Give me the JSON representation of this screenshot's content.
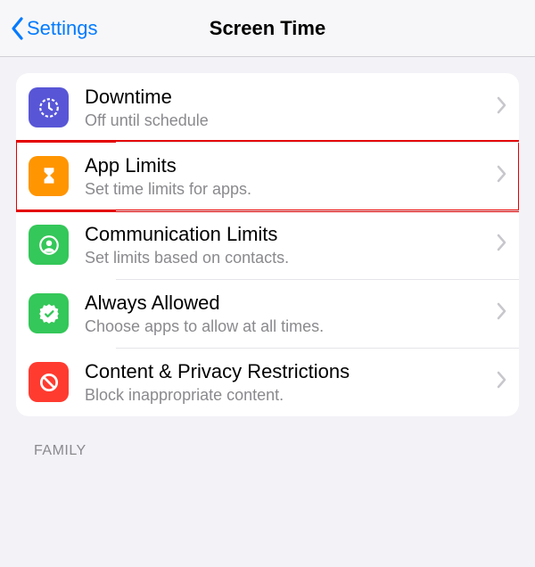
{
  "nav": {
    "back": "Settings",
    "title": "Screen Time"
  },
  "rows": [
    {
      "title": "Downtime",
      "sub": "Off until schedule",
      "iconColor": "#5856d6",
      "iconName": "clock-icon",
      "highlight": false
    },
    {
      "title": "App Limits",
      "sub": "Set time limits for apps.",
      "iconColor": "#ff9500",
      "iconName": "hourglass-icon",
      "highlight": true
    },
    {
      "title": "Communication Limits",
      "sub": "Set limits based on contacts.",
      "iconColor": "#34c759",
      "iconName": "contact-icon",
      "highlight": false
    },
    {
      "title": "Always Allowed",
      "sub": "Choose apps to allow at all times.",
      "iconColor": "#34c759",
      "iconName": "check-badge-icon",
      "highlight": false
    },
    {
      "title": "Content & Privacy Restrictions",
      "sub": "Block inappropriate content.",
      "iconColor": "#ff3b30",
      "iconName": "no-entry-icon",
      "highlight": false
    }
  ],
  "sectionLabel": "FAMILY"
}
